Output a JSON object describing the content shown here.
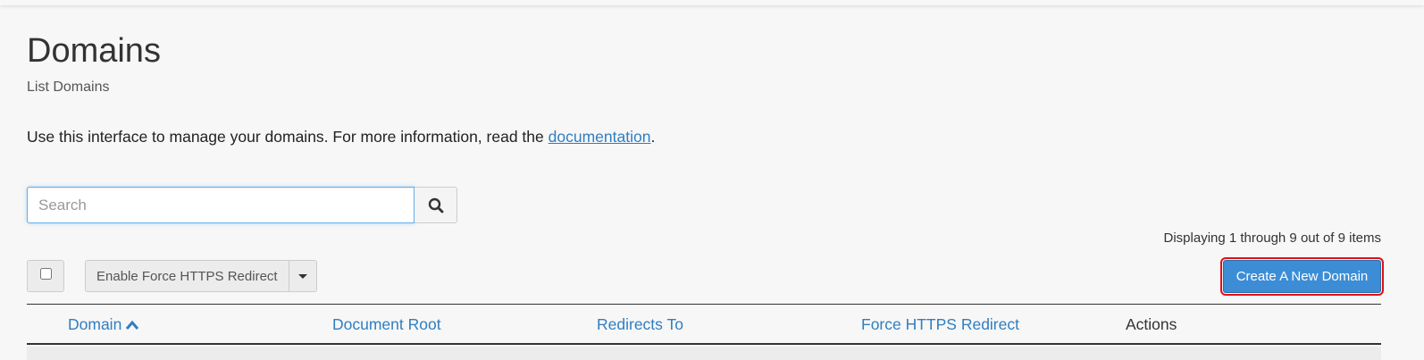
{
  "header": {
    "title": "Domains",
    "subtitle": "List Domains"
  },
  "description": {
    "text_before": "Use this interface to manage your domains. For more information, read the ",
    "link_text": "documentation",
    "text_after": "."
  },
  "search": {
    "placeholder": "Search",
    "value": "",
    "button_icon": "search-icon"
  },
  "pagination": {
    "info": "Displaying 1 through 9 out of 9 items"
  },
  "toolbar": {
    "bulk_action_label": "Enable Force HTTPS Redirect",
    "dropdown_icon": "chevron-down-icon",
    "create_button_label": "Create A New Domain"
  },
  "table": {
    "columns": [
      {
        "label": "Domain",
        "sortable": true,
        "sort": "ascending"
      },
      {
        "label": "Document Root",
        "sortable": true
      },
      {
        "label": "Redirects To",
        "sortable": true
      },
      {
        "label": "Force HTTPS Redirect",
        "sortable": true
      },
      {
        "label": "Actions",
        "sortable": false
      }
    ]
  },
  "colors": {
    "accent": "#2f7ec1",
    "primary_button": "#3c8dd6",
    "highlight_outline": "#e0101a",
    "background": "#f7f7f7"
  }
}
